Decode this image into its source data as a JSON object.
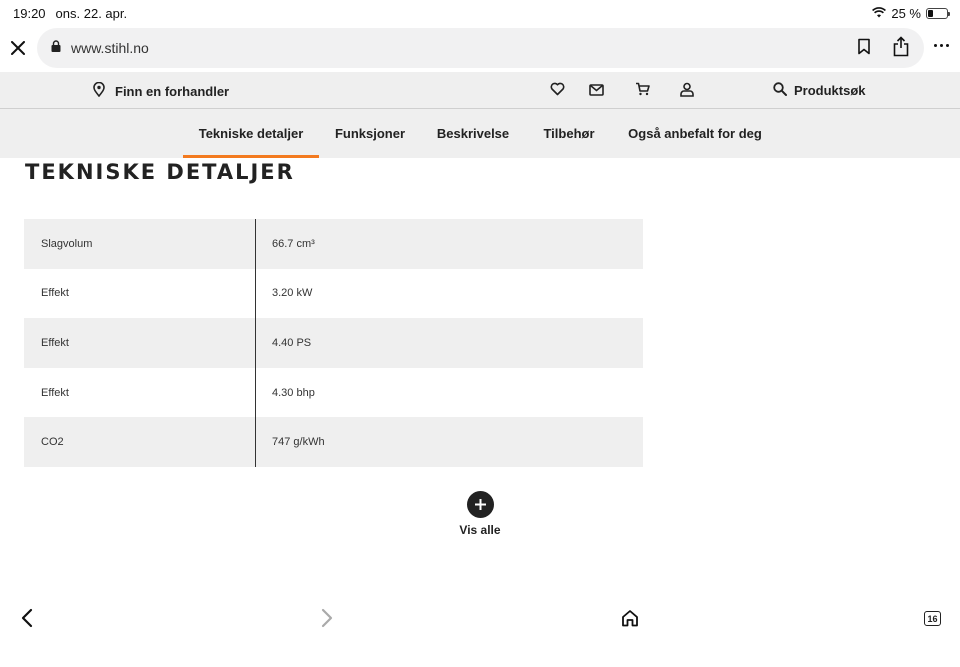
{
  "status_bar": {
    "time": "19:20",
    "date": "ons. 22. apr.",
    "battery": "25 %",
    "battery_level_percent": 25
  },
  "browser": {
    "url": "www.stihl.no",
    "open_tabs_count": "16"
  },
  "site_header": {
    "dealer_link": "Finn en forhandler",
    "product_search": "Produktsøk"
  },
  "tabs": [
    {
      "label": "Tekniske detaljer",
      "active": true
    },
    {
      "label": "Funksjoner"
    },
    {
      "label": "Beskrivelse"
    },
    {
      "label": "Tilbehør"
    },
    {
      "label": "Også anbefalt for deg"
    }
  ],
  "section": {
    "title": "TEKNISKE DETALJER"
  },
  "specs": [
    {
      "label": "Slagvolum",
      "value": "66.7 cm³"
    },
    {
      "label": "Effekt",
      "value": "3.20 kW"
    },
    {
      "label": "Effekt",
      "value": "4.40 PS"
    },
    {
      "label": "Effekt",
      "value": "4.30 bhp"
    },
    {
      "label": "CO2",
      "value": "747 g/kWh"
    }
  ],
  "show_all": {
    "label": "Vis alle"
  },
  "colors": {
    "accent": "#f37a1f",
    "bar_bg": "#efefef",
    "text": "#222222"
  }
}
